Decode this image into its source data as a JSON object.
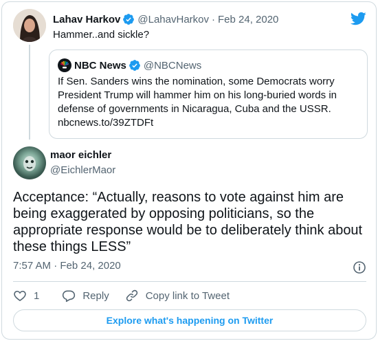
{
  "parent_tweet": {
    "name": "Lahav Harkov",
    "handle": "@LahavHarkov",
    "date": "Feb 24, 2020",
    "text": "Hammer..and sickle?"
  },
  "quoted_tweet": {
    "name": "NBC News",
    "handle": "@NBCNews",
    "text_lines": [
      "If Sen. Sanders wins the nomination, some Democrats worry",
      "President Trump will hammer him on his long-buried words in",
      "defense of governments in Nicaragua, Cuba and the USSR.",
      "nbcnews.to/39ZTDFt"
    ]
  },
  "main_tweet": {
    "name": "maor eichler",
    "handle": "@EichlerMaor",
    "text_lines": [
      "Acceptance: “Actually, reasons to vote against him are",
      "being exaggerated by opposing politicians, so the",
      "appropriate response would be to deliberately think about",
      "these things LESS”"
    ],
    "timestamp": "7:57 AM · Feb 24, 2020"
  },
  "actions": {
    "like_count": "1",
    "reply_label": "Reply",
    "copy_link_label": "Copy link to Tweet"
  },
  "explore_button": "Explore what's happening on Twitter",
  "separator": "·",
  "icons": [
    "verified-badge-icon",
    "twitter-bird-icon",
    "info-icon",
    "heart-icon",
    "reply-bubble-icon",
    "link-icon",
    "nbc-peacock-icon"
  ],
  "colors": {
    "accent": "#1d9bf0",
    "secondary_text": "#536471",
    "border": "#cfd9de"
  }
}
